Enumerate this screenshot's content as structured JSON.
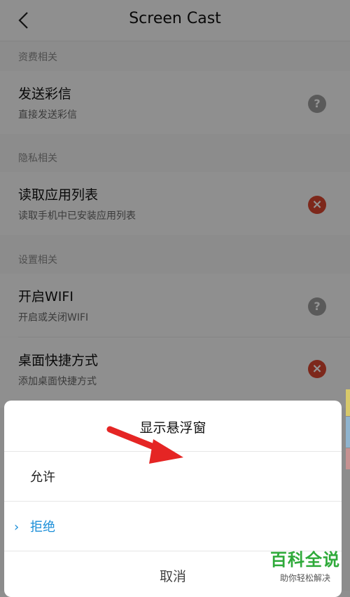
{
  "header": {
    "title": "Screen Cast"
  },
  "sections": [
    {
      "heading": "资费相关",
      "items": [
        {
          "title": "发送彩信",
          "subtitle": "直接发送彩信",
          "status": "question-icon"
        }
      ]
    },
    {
      "heading": "隐私相关",
      "items": [
        {
          "title": "读取应用列表",
          "subtitle": "读取手机中已安装应用列表",
          "status": "denied-icon"
        }
      ]
    },
    {
      "heading": "设置相关",
      "items": [
        {
          "title": "开启WIFI",
          "subtitle": "开启或关闭WIFI",
          "status": "question-icon"
        },
        {
          "title": "桌面快捷方式",
          "subtitle": "添加桌面快捷方式",
          "status": "denied-icon"
        }
      ]
    }
  ],
  "dialog": {
    "title": "显示悬浮窗",
    "options": [
      {
        "label": "允许",
        "selected": false
      },
      {
        "label": "拒绝",
        "selected": true
      }
    ],
    "cancel_label": "取消"
  },
  "icons": {
    "question": "?",
    "denied": "×",
    "chevron": "›"
  },
  "watermark": {
    "brand": "百科全说",
    "tagline": "助你轻松解决"
  },
  "colors": {
    "accent": "#1a8ed8",
    "deny": "#d8452f",
    "arrow": "#e52524",
    "watermark": "#2faa3a"
  }
}
